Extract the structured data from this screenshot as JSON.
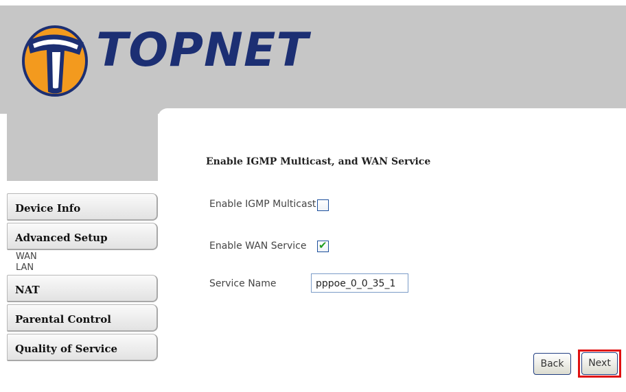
{
  "brand": {
    "name": "TOPNET",
    "logo_letter": "T"
  },
  "sidebar": {
    "items": [
      {
        "label": "Device Info"
      },
      {
        "label": "Advanced Setup",
        "children": [
          "WAN",
          "LAN"
        ]
      },
      {
        "label": "NAT"
      },
      {
        "label": "Parental Control"
      },
      {
        "label": "Quality of Service"
      }
    ]
  },
  "main": {
    "title": "Enable IGMP Multicast, and WAN Service",
    "igmp": {
      "label": "Enable IGMP Multicast",
      "checked": false
    },
    "wan": {
      "label": "Enable WAN Service",
      "checked": true
    },
    "service": {
      "label": "Service Name",
      "value": "pppoe_0_0_35_1"
    },
    "buttons": {
      "back": "Back",
      "next": "Next"
    }
  },
  "colors": {
    "header_bg": "#c6c6c6",
    "logo_blue": "#1c2f73",
    "logo_orange": "#f39a1e",
    "highlight": "#e01010"
  }
}
